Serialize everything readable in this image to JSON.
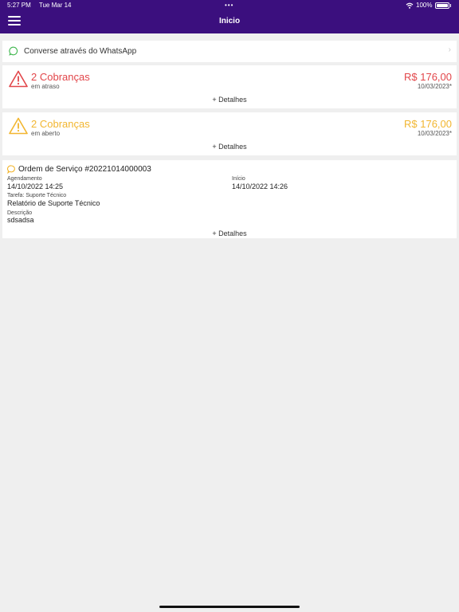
{
  "status_bar": {
    "time": "5:27 PM",
    "date": "Tue Mar 14",
    "dots": "•••",
    "battery": "100%"
  },
  "header": {
    "title": "Inicio"
  },
  "whatsapp": {
    "label": "Converse através do WhatsApp",
    "chevron": "›"
  },
  "bills": [
    {
      "count_label": "2 Cobranças",
      "status": "em atraso",
      "amount": "R$ 176,00",
      "date": "10/03/2023*",
      "details": "+ Detalhes",
      "color": "#e2464a"
    },
    {
      "count_label": "2 Cobranças",
      "status": "em aberto",
      "amount": "R$ 176,00",
      "date": "10/03/2023*",
      "details": "+ Detalhes",
      "color": "#f2b630"
    }
  ],
  "service_order": {
    "title": "Ordem de Serviço #20221014000003",
    "schedule_label": "Agendamento",
    "schedule_value": "14/10/2022 14:25",
    "start_label": "Início",
    "start_value": "14/10/2022 14:26",
    "task_label": "Tarefa: Suporte Técnico",
    "task_value": "Relatório de Suporte Técnico",
    "description_label": "Descrição",
    "description_value": "sdsadsa",
    "details": "+ Detalhes"
  },
  "colors": {
    "header_bg": "#3b0f7e",
    "background": "#efefef",
    "overdue": "#e2464a",
    "open": "#f2b630",
    "whatsapp": "#3bb54a"
  }
}
